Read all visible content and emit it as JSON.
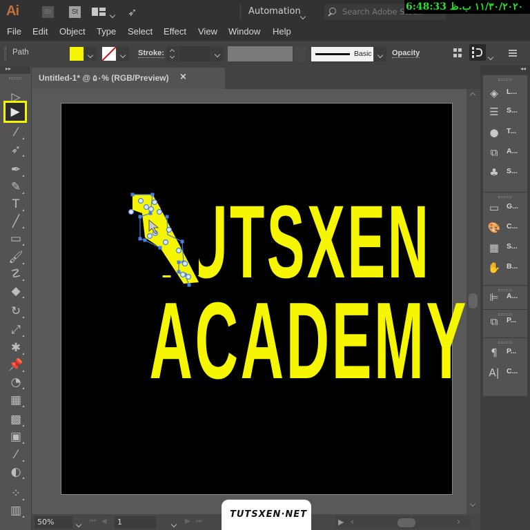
{
  "app": {
    "logo": "Ai",
    "bridge_chip": "Br",
    "stock_chip": "St",
    "workspace": "Automation",
    "search_placeholder": "Search Adobe Stock",
    "clock_overlay": "6:48:33 ١١/٣٠/٢٠٢٠ ب.ظ"
  },
  "menu": [
    "File",
    "Edit",
    "Object",
    "Type",
    "Select",
    "Effect",
    "View",
    "Window",
    "Help"
  ],
  "control_bar": {
    "selection_type": "Path",
    "fill_color": "#f6f600",
    "stroke_color": "none",
    "stroke_label": "Stroke:",
    "stroke_value": "",
    "brush_label": "Basic",
    "opacity_label": "Opacity"
  },
  "document": {
    "tab_title": "Untitled-1* @ ۵۰% (RGB/Preview)",
    "close_glyph": "×"
  },
  "artwork": {
    "line1": "TUTSXEN",
    "line2": "ACADEMY",
    "text_color": "#f6f600",
    "background": "#000000"
  },
  "toolbar": {
    "selected_tool": "direct-selection",
    "tools": [
      {
        "name": "selection-tool",
        "glyph": "▷"
      },
      {
        "name": "direct-selection-tool",
        "glyph": "▶"
      },
      {
        "name": "magic-wand-tool",
        "glyph": "⁄"
      },
      {
        "name": "lasso-tool",
        "glyph": "➶"
      },
      {
        "name": "pen-tool",
        "glyph": "✒"
      },
      {
        "name": "curvature-tool",
        "glyph": "✎"
      },
      {
        "name": "type-tool",
        "glyph": "T"
      },
      {
        "name": "line-tool",
        "glyph": "╱"
      },
      {
        "name": "rectangle-tool",
        "glyph": "▭"
      },
      {
        "name": "paintbrush-tool",
        "glyph": "🖌"
      },
      {
        "name": "shaper-tool",
        "glyph": "☡"
      },
      {
        "name": "eraser-tool",
        "glyph": "◆"
      },
      {
        "name": "rotate-tool",
        "glyph": "↻"
      },
      {
        "name": "scale-tool",
        "glyph": "⤢"
      },
      {
        "name": "puppet-warp-tool",
        "glyph": "✱"
      },
      {
        "name": "pin-tool",
        "glyph": "📌"
      },
      {
        "name": "shape-builder-tool",
        "glyph": "◔"
      },
      {
        "name": "perspective-grid-tool",
        "glyph": "▦"
      },
      {
        "name": "mesh-tool",
        "glyph": "▩"
      },
      {
        "name": "gradient-tool",
        "glyph": "▣"
      },
      {
        "name": "eyedropper-tool",
        "glyph": "⁄"
      },
      {
        "name": "blend-tool",
        "glyph": "◐"
      },
      {
        "name": "symbol-sprayer-tool",
        "glyph": "⁘"
      },
      {
        "name": "column-graph-tool",
        "glyph": "▥"
      }
    ]
  },
  "panels": [
    {
      "group": 1,
      "items": [
        {
          "name": "layers",
          "label": "L...",
          "glyph": "◈"
        },
        {
          "name": "stroke",
          "label": "S...",
          "glyph": "☰"
        },
        {
          "name": "transparency",
          "label": "T...",
          "glyph": "●"
        },
        {
          "name": "appearance",
          "label": "A...",
          "glyph": "⧉"
        },
        {
          "name": "symbols",
          "label": "S...",
          "glyph": "♣"
        }
      ]
    },
    {
      "group": 2,
      "items": [
        {
          "name": "gradient",
          "label": "G...",
          "glyph": "▭"
        },
        {
          "name": "color",
          "label": "C...",
          "glyph": "🎨"
        },
        {
          "name": "swatches",
          "label": "S...",
          "glyph": "▦"
        },
        {
          "name": "brushes",
          "label": "B...",
          "glyph": "✋"
        }
      ]
    },
    {
      "group": 3,
      "items": [
        {
          "name": "align",
          "label": "A...",
          "glyph": "⊫"
        }
      ]
    },
    {
      "group": 4,
      "items": [
        {
          "name": "pathfinder",
          "label": "P...",
          "glyph": "⧉"
        }
      ]
    },
    {
      "group": 5,
      "items": [
        {
          "name": "paragraph",
          "label": "P...",
          "glyph": "¶"
        },
        {
          "name": "character",
          "label": "C...",
          "glyph": "A|"
        }
      ]
    }
  ],
  "status_bar": {
    "zoom": "50%",
    "page": "1"
  },
  "watermark": "TUTSXEN·NET"
}
